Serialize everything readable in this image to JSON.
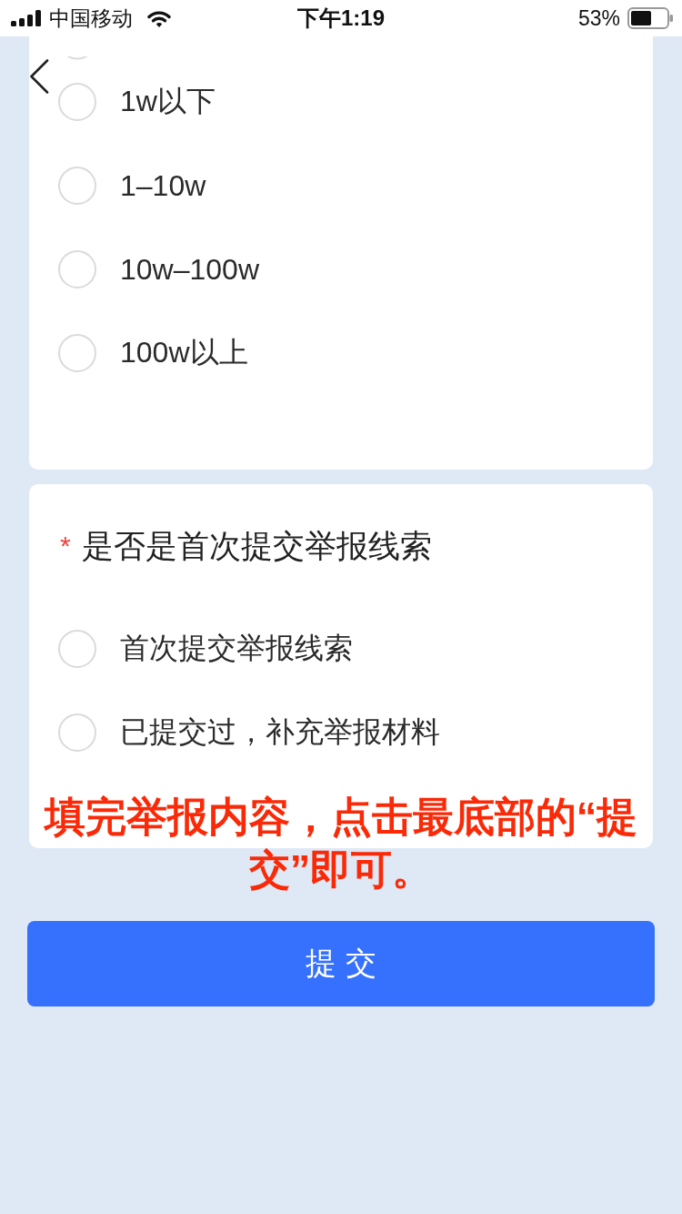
{
  "status_bar": {
    "carrier": "中国移动",
    "time": "下午1:19",
    "battery": "53%"
  },
  "questions": [
    {
      "options": [
        {
          "clipped": true,
          "selected": false
        },
        {
          "label": "1w以下",
          "selected": false
        },
        {
          "label": "1–10w",
          "selected": false
        },
        {
          "label": "10w–100w",
          "selected": false
        },
        {
          "label": "100w以上",
          "selected": false
        }
      ]
    },
    {
      "required_mark": "*",
      "title": "是否是首次提交举报线索",
      "options": [
        {
          "label": "首次提交举报线索",
          "selected": false
        },
        {
          "label": "已提交过，补充举报材料",
          "selected": false
        }
      ]
    }
  ],
  "annotation": "填完举报内容，点击最底部的“提交”即可。",
  "submit_button": "提 交"
}
